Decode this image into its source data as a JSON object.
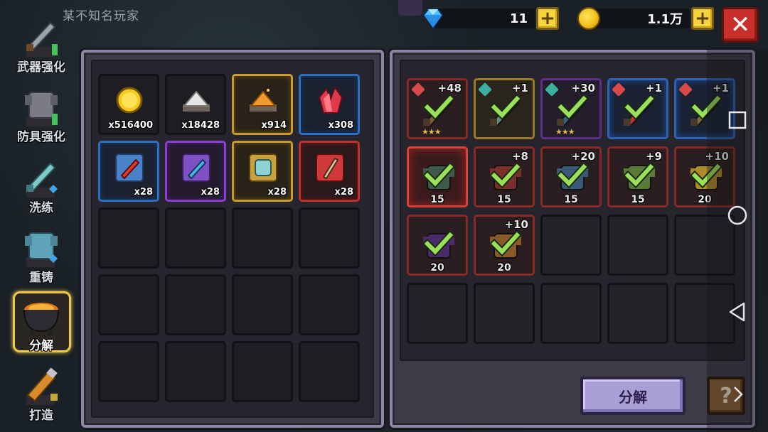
{
  "player": {
    "name": "某不知名玩家"
  },
  "currency": {
    "gems": {
      "value": "11",
      "icon": "diamond-icon"
    },
    "gold": {
      "value": "1.1万",
      "icon": "coin-icon"
    },
    "plus_label": "+"
  },
  "close_label": "✕",
  "sidebar": {
    "items": [
      {
        "label": "武器强化",
        "icon": "sword-upgrade-icon",
        "active": false
      },
      {
        "label": "防具强化",
        "icon": "armor-upgrade-icon",
        "active": false
      },
      {
        "label": "洗练",
        "icon": "reforge-sword-icon",
        "active": false
      },
      {
        "label": "重铸",
        "icon": "recast-armor-icon",
        "active": false
      },
      {
        "label": "分解",
        "icon": "cauldron-icon",
        "active": true
      },
      {
        "label": "打造",
        "icon": "forge-hammer-icon",
        "active": false
      }
    ]
  },
  "materials": {
    "items": [
      {
        "name": "gold-coin",
        "count": "x516400",
        "quality": "none"
      },
      {
        "name": "silver-ore-pile",
        "count": "x18428",
        "quality": "none"
      },
      {
        "name": "orange-ore-pile",
        "count": "x914",
        "quality": "gold"
      },
      {
        "name": "red-crystal",
        "count": "x308",
        "quality": "blue"
      },
      {
        "name": "red-sword-blueprint",
        "count": "x28",
        "quality": "blue"
      },
      {
        "name": "blue-weapon-blueprint",
        "count": "x28",
        "quality": "purple"
      },
      {
        "name": "armor-blueprint",
        "count": "x28",
        "quality": "gold"
      },
      {
        "name": "red-staff-blueprint",
        "count": "x28",
        "quality": "red"
      }
    ],
    "empty_slots": 12
  },
  "equipment": {
    "items": [
      {
        "level": "+48",
        "stars": "★★★",
        "rarity": "red",
        "tag": "red",
        "num": ""
      },
      {
        "level": "+1",
        "stars": "",
        "rarity": "gold",
        "tag": "teal",
        "num": ""
      },
      {
        "level": "+30",
        "stars": "★★★",
        "rarity": "purple",
        "tag": "teal",
        "num": ""
      },
      {
        "level": "+1",
        "stars": "",
        "rarity": "blue",
        "tag": "red",
        "num": ""
      },
      {
        "level": "+1",
        "stars": "",
        "rarity": "blue",
        "tag": "red",
        "num": ""
      },
      {
        "level": "",
        "stars": "",
        "rarity": "redglow",
        "tag": "",
        "num": "15"
      },
      {
        "level": "+8",
        "stars": "",
        "rarity": "red",
        "tag": "",
        "num": "15"
      },
      {
        "level": "+20",
        "stars": "",
        "rarity": "red",
        "tag": "",
        "num": "15"
      },
      {
        "level": "+9",
        "stars": "",
        "rarity": "red",
        "tag": "",
        "num": "15"
      },
      {
        "level": "+10",
        "stars": "",
        "rarity": "red",
        "tag": "",
        "num": "20"
      },
      {
        "level": "",
        "stars": "",
        "rarity": "red",
        "tag": "",
        "num": "20"
      },
      {
        "level": "+10",
        "stars": "",
        "rarity": "red",
        "tag": "",
        "num": "20"
      }
    ],
    "empty_slots": 8
  },
  "decompose_button": "分解",
  "help_button": "?",
  "colors": {
    "panel": "#3e3b48",
    "panel_border": "#8b87a2",
    "check": "#9be05a",
    "accent_gold": "#f1c84a",
    "close_red": "#c9302c"
  }
}
